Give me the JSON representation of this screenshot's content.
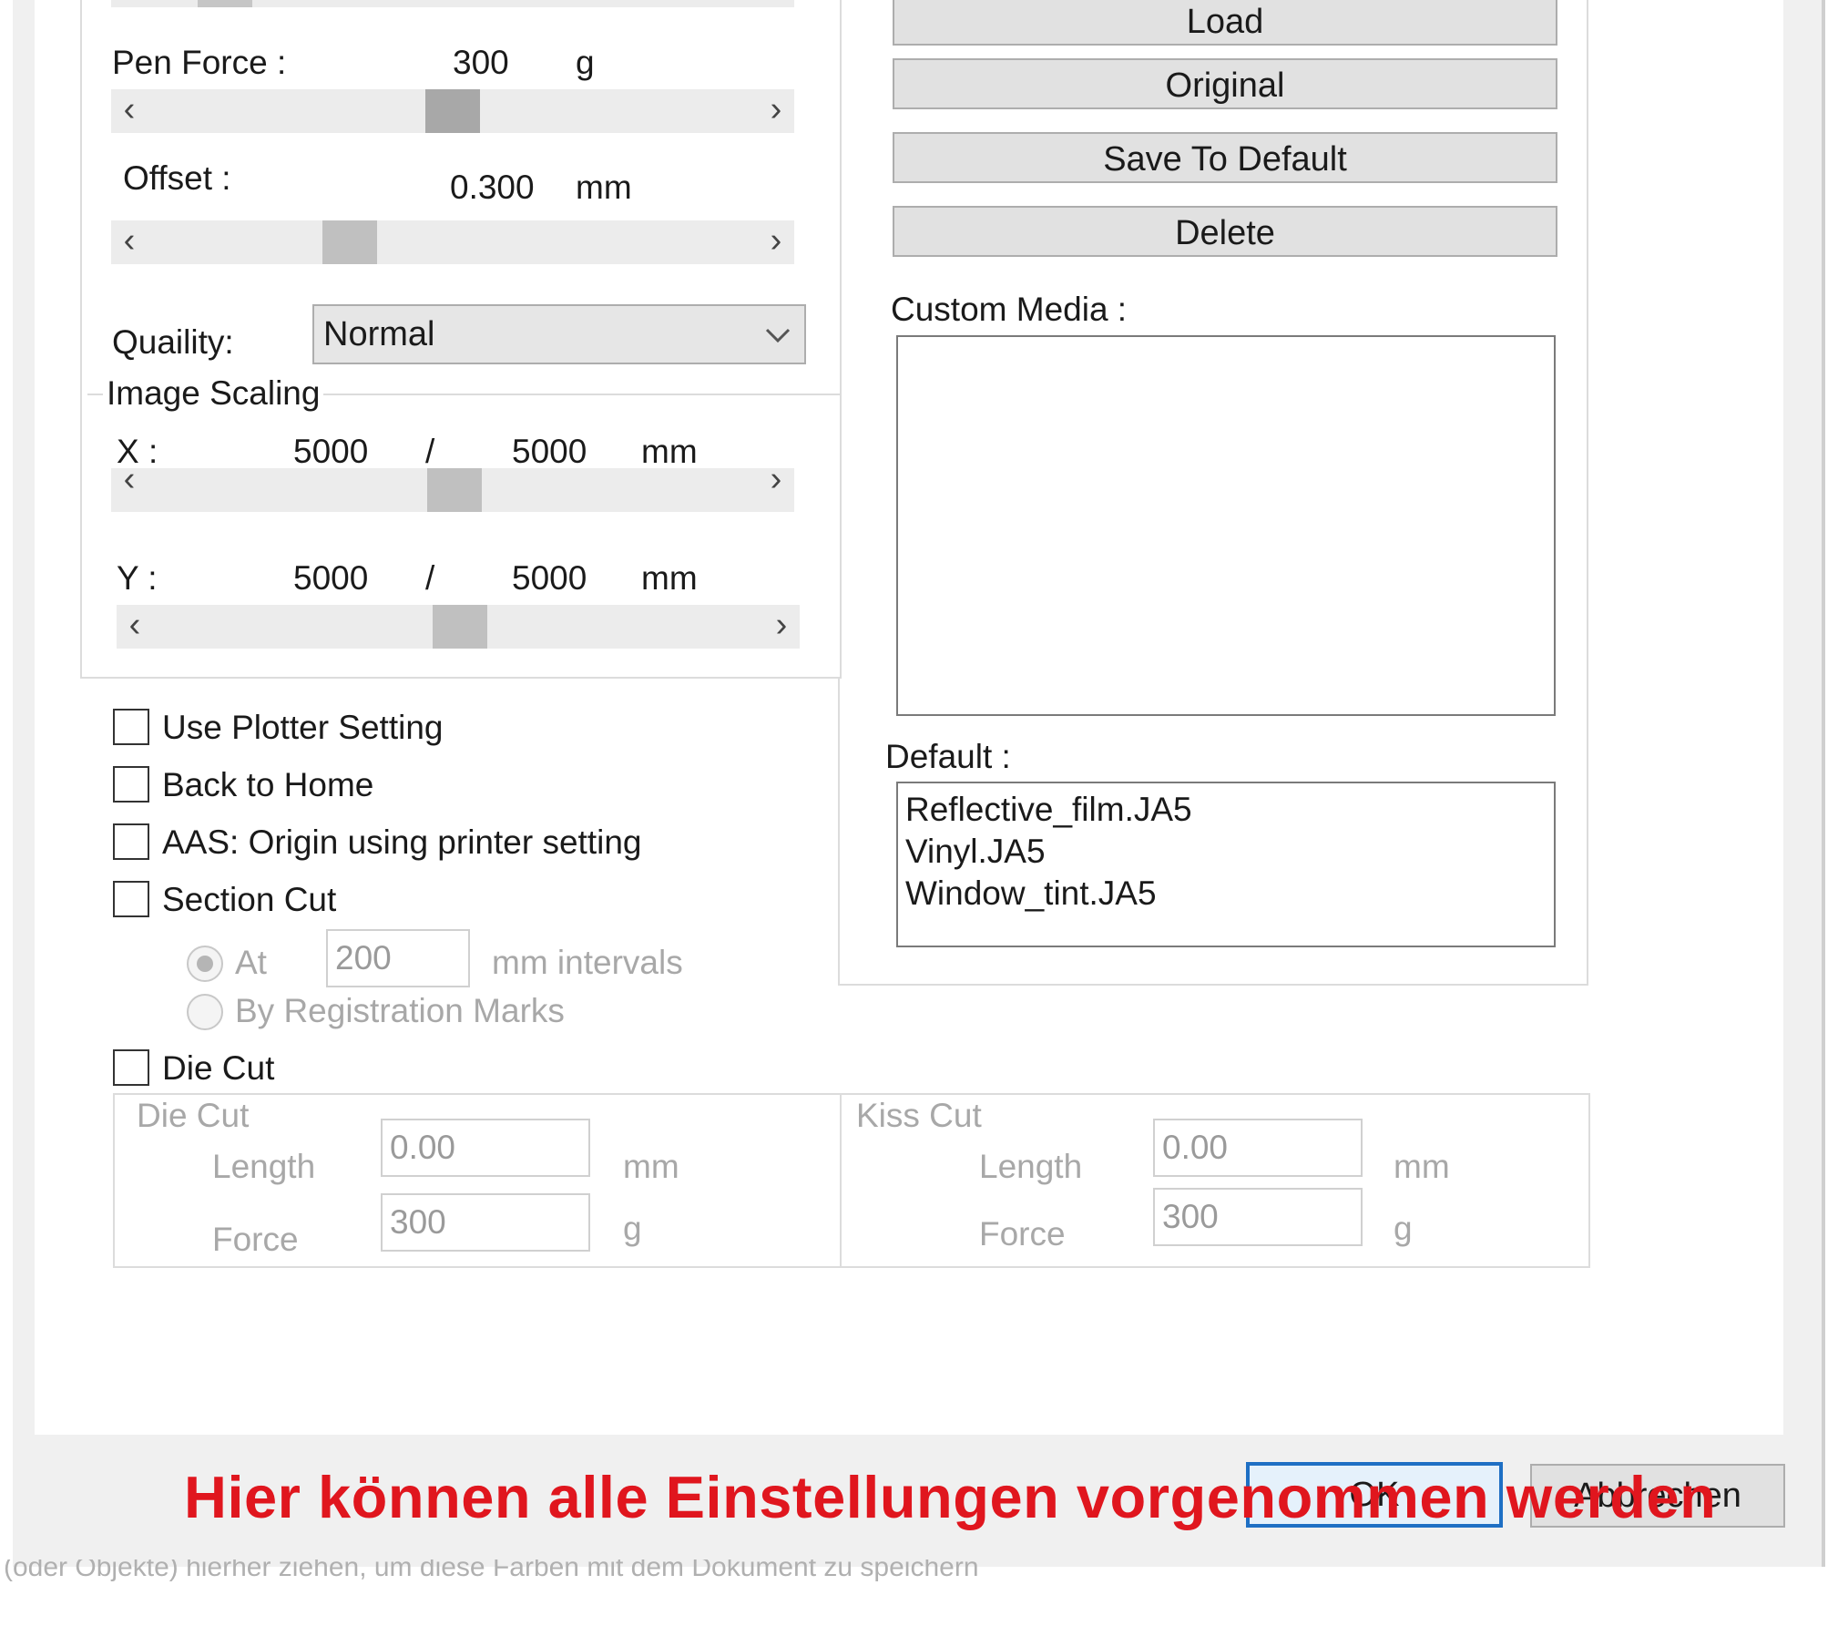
{
  "left": {
    "pen_force": {
      "label": "Pen Force :",
      "value": "300",
      "unit": "g",
      "level": 0.5
    },
    "offset": {
      "label": "Offset :",
      "value": "0.300",
      "unit": "mm",
      "level": 0.33
    },
    "quality": {
      "label": "Quaility:",
      "selected": "Normal"
    },
    "image_scaling": {
      "title": "Image Scaling",
      "x": {
        "label": "X :",
        "value": "5000",
        "sep": "/",
        "max": "5000",
        "unit": "mm",
        "level": 0.5
      },
      "y": {
        "label": "Y :",
        "value": "5000",
        "sep": "/",
        "max": "5000",
        "unit": "mm",
        "level": 0.5
      }
    },
    "checkboxes": {
      "use_plotter": "Use Plotter Setting",
      "back_home": "Back to Home",
      "aas": "AAS: Origin using printer setting",
      "section_cut": "Section Cut",
      "die_cut": "Die Cut"
    },
    "section_cut": {
      "at_label": "At",
      "at_value": "200",
      "interval_unit": "mm intervals",
      "registration": "By Registration Marks"
    },
    "die_cut_group": {
      "title": "Die Cut",
      "length_label": "Length",
      "length_value": "0.00",
      "length_unit": "mm",
      "force_label": "Force",
      "force_value": "300",
      "force_unit": "g"
    },
    "kiss_cut_group": {
      "title": "Kiss Cut",
      "length_label": "Length",
      "length_value": "0.00",
      "length_unit": "mm",
      "force_label": "Force",
      "force_value": "300",
      "force_unit": "g"
    }
  },
  "right": {
    "buttons": {
      "load": "Load",
      "original": "Original",
      "save_default": "Save To Default",
      "delete": "Delete"
    },
    "custom_media_label": "Custom Media :",
    "default_label": "Default :",
    "default_items": [
      "Reflective_film.JA5",
      "Vinyl.JA5",
      "Window_tint.JA5"
    ]
  },
  "footer": {
    "ok": "OK",
    "cancel": "Abbrechen",
    "overlay_text": "Hier können alle Einstellungen vorgenommen werden",
    "status_text": "(oder Objekte) hierher ziehen, um diese Farben mit dem Dokument zu speichern"
  },
  "colors": {
    "overlay": "#e0161e",
    "focus": "#1e6fc4"
  }
}
